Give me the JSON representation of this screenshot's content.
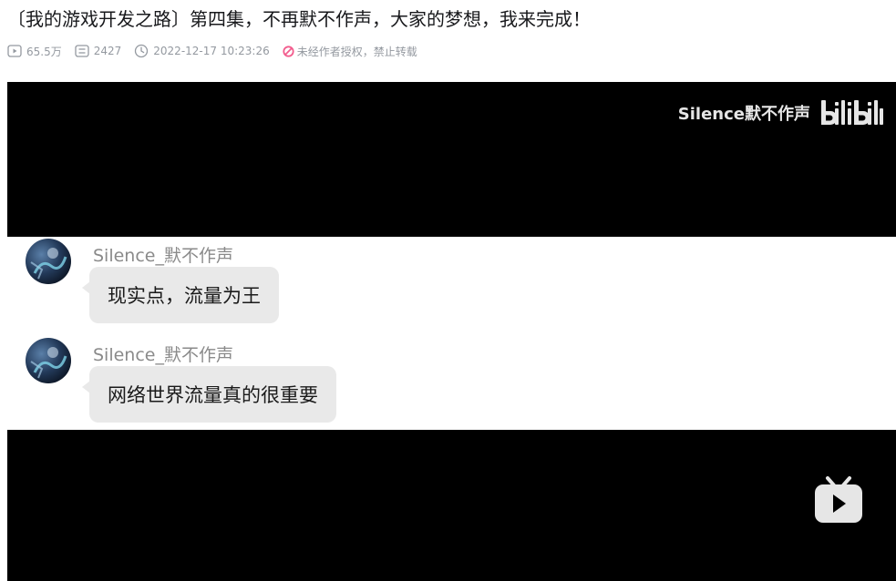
{
  "video": {
    "title": "〔我的游戏开发之路〕第四集，不再默不作声，大家的梦想，我来完成！",
    "views": "65.5万",
    "danmaku_count": "2427",
    "publish_time": "2022-12-17 10:23:26",
    "copyright_notice": "未经作者授权，禁止转载"
  },
  "player": {
    "watermark_name": "Silence默不作声",
    "watermark_logo": "bilibili",
    "chat": [
      {
        "sender": "Silence_默不作声",
        "text": "现实点，流量为王"
      },
      {
        "sender": "Silence_默不作声",
        "text": "网络世界流量真的很重要"
      }
    ]
  },
  "colors": {
    "meta_gray": "#9499a0",
    "warn_red": "#f25d8e",
    "bubble_bg": "#e9e9e9",
    "player_bg": "#000000"
  },
  "icons": [
    "play-count-icon",
    "danmaku-icon",
    "clock-icon",
    "no-reprint-icon",
    "bilibili-tv-icon"
  ]
}
